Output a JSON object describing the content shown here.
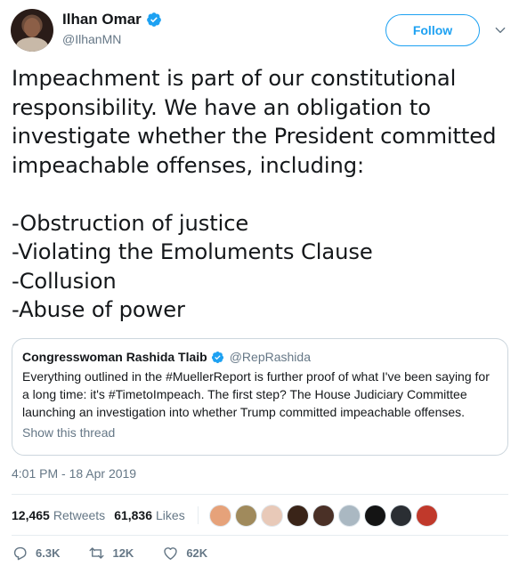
{
  "author": {
    "name": "Ilhan Omar",
    "handle": "@IlhanMN",
    "verified": true
  },
  "follow_label": "Follow",
  "tweet_text": "Impeachment is part of our constitutional responsibility. We have an obligation to investigate whether the President committed impeachable offenses, including:\n\n-Obstruction of justice\n-Violating the Emoluments Clause\n-Collusion\n-Abuse of power",
  "quoted": {
    "name": "Congresswoman Rashida Tlaib",
    "handle": "@RepRashida",
    "verified": true,
    "text": "Everything outlined in the #MuellerReport is further proof of what I've been saying for a long time: it's #TimetoImpeach. The first step? The House Judiciary Committee launching an investigation into whether Trump committed impeachable offenses.",
    "show_thread": "Show this thread"
  },
  "timestamp": "4:01 PM - 18 Apr 2019",
  "stats": {
    "retweets_count": "12,465",
    "retweets_label": "Retweets",
    "likes_count": "61,836",
    "likes_label": "Likes"
  },
  "likers": [
    "#e6a27a",
    "#a08a5c",
    "#e8c9b8",
    "#3a2418",
    "#4a3026",
    "#aab8c2",
    "#141414",
    "#2a2e33",
    "#c0392b"
  ],
  "actions": {
    "replies": "6.3K",
    "retweets": "12K",
    "likes": "62K"
  },
  "colors": {
    "accent": "#1da1f2",
    "muted": "#657786",
    "border": "#e6ecf0"
  }
}
